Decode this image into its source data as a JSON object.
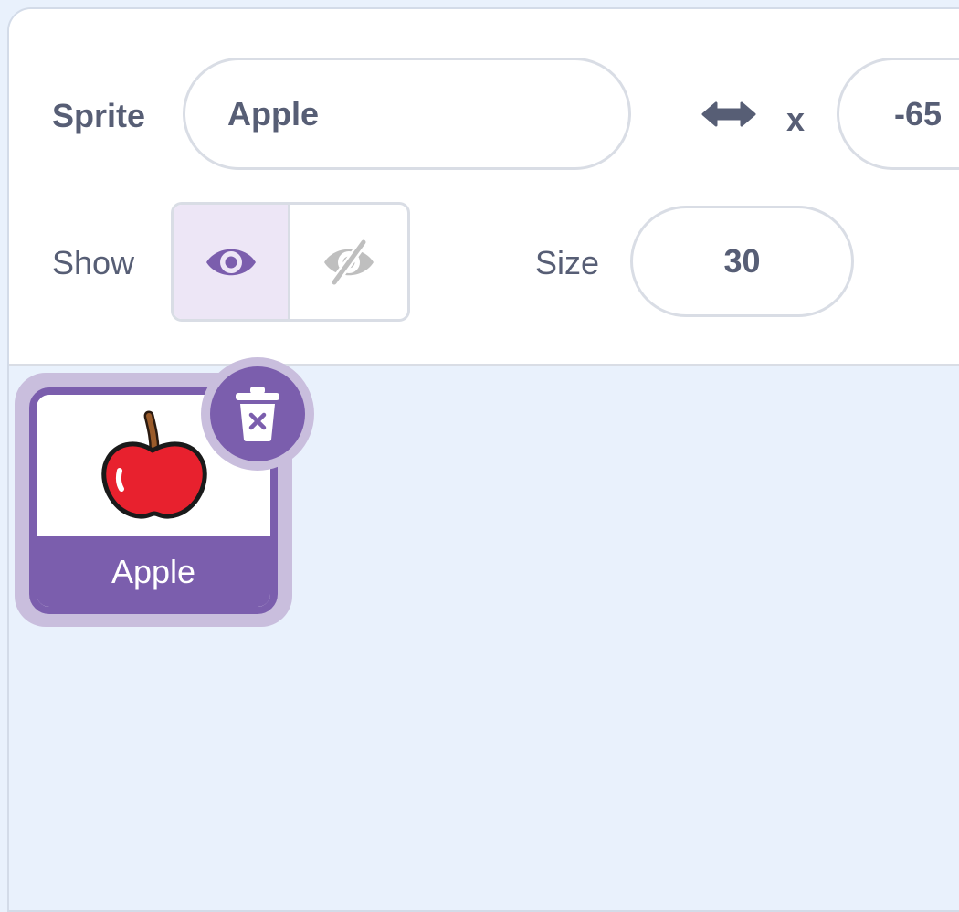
{
  "sprite": {
    "label": "Sprite",
    "name": "Apple"
  },
  "x": {
    "label": "x",
    "value": "-65"
  },
  "show": {
    "label": "Show",
    "visible": true
  },
  "size": {
    "label": "Size",
    "value": "30"
  },
  "sprites": [
    {
      "name": "Apple",
      "selected": true
    }
  ],
  "colors": {
    "accent": "#7b5ead",
    "text": "#575e75",
    "background": "#e9f1fc"
  },
  "icons": {
    "x_direction": "horizontal-arrow-icon",
    "show": "eye-icon",
    "hide": "eye-slash-icon",
    "delete": "trash-icon",
    "thumb": "apple-icon"
  }
}
